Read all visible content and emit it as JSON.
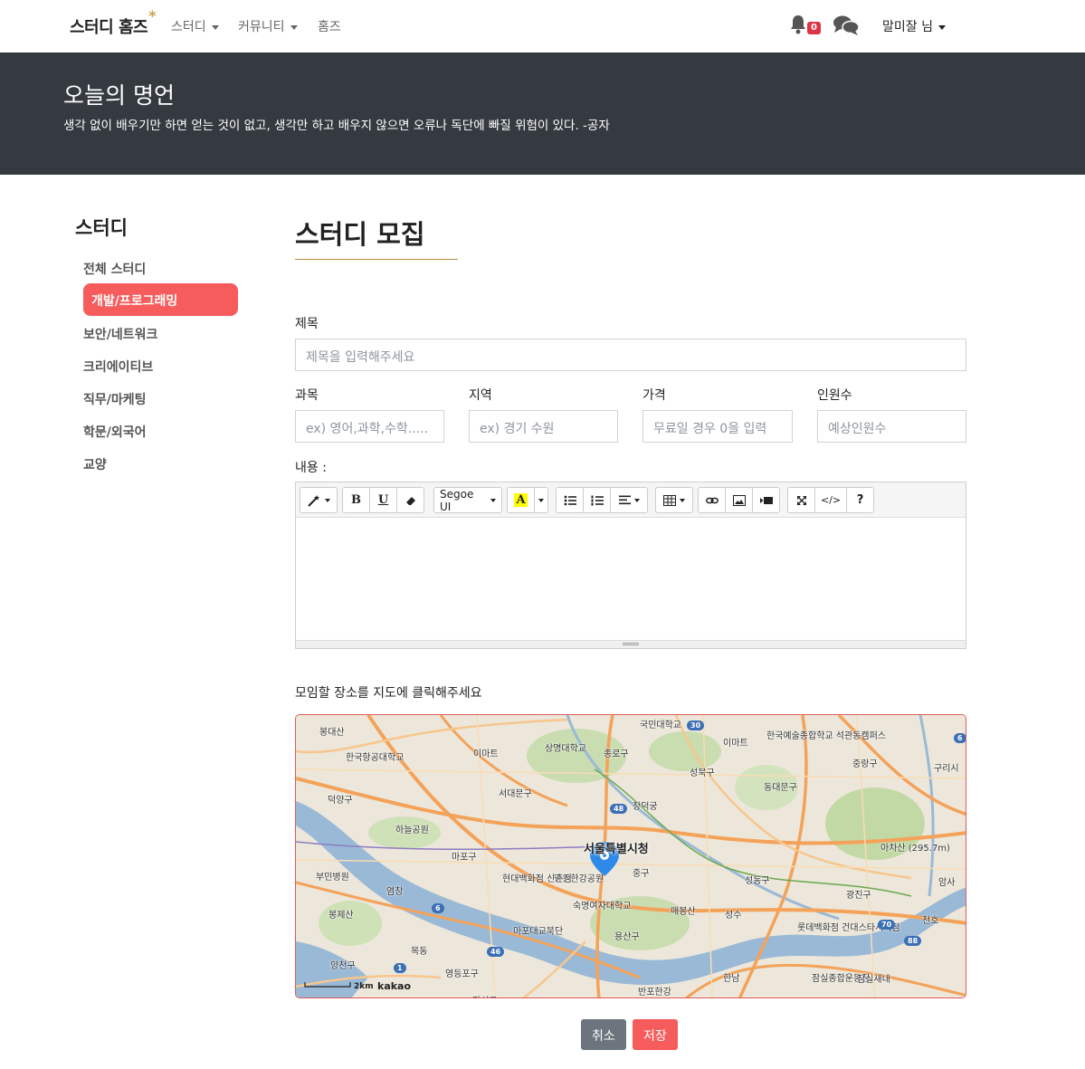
{
  "navbar": {
    "brand": "스터디 홈즈",
    "brand_mark": "*",
    "menu": [
      {
        "label": "스터디",
        "dropdown": true
      },
      {
        "label": "커뮤니티",
        "dropdown": true
      },
      {
        "label": "홈즈",
        "dropdown": false
      }
    ],
    "notification_count": "0",
    "user_label": "말미잘 님"
  },
  "hero": {
    "title": "오늘의 명언",
    "quote": "생각 없이 배우기만 하면 얻는 것이 없고, 생각만 하고 배우지 않으면 오류나 독단에 빠질 위험이 있다. -공자"
  },
  "sidebar": {
    "title": "스터디",
    "items": [
      {
        "label": "전체 스터디",
        "active": false
      },
      {
        "label": "개발/프로그래밍",
        "active": true
      },
      {
        "label": "보안/네트워크",
        "active": false
      },
      {
        "label": "크리에이티브",
        "active": false
      },
      {
        "label": "직무/마케팅",
        "active": false
      },
      {
        "label": "학문/외국어",
        "active": false
      },
      {
        "label": "교양",
        "active": false
      }
    ]
  },
  "form": {
    "page_title": "스터디 모집",
    "title_label": "제목",
    "title_placeholder": "제목을 입력해주세요",
    "subject_label": "과목",
    "subject_placeholder": "ex) 영어,과학,수학.....",
    "region_label": "지역",
    "region_placeholder": "ex) 경기 수원",
    "price_label": "가격",
    "price_placeholder": "무료일 경우 0을 입력",
    "people_label": "인원수",
    "people_placeholder": "예상인원수",
    "content_label": "내용 :",
    "editor": {
      "font_name": "Segoe UI",
      "bold": "B",
      "underline": "U",
      "highlight": "A",
      "help": "?",
      "code": "</>"
    },
    "map_instruction": "모임할 장소를 지도에 클릭해주세요",
    "cancel_label": "취소",
    "save_label": "저장"
  },
  "map": {
    "scale_label": "2km",
    "provider": "kakao",
    "center_label": "서울특별시청",
    "places": [
      "봉대산",
      "한국항공대학교",
      "이마트",
      "상명대학교",
      "종로구",
      "국민대학교",
      "이마트",
      "한국예술종합학교 석관동캠퍼스",
      "중랑구",
      "구리시",
      "덕양구",
      "성북구",
      "동대문구",
      "서대문구",
      "창덕궁",
      "하늘공원",
      "마포구",
      "중구",
      "아차산 (295.7m)",
      "부민병원",
      "망원한강공원",
      "현대백화점 신촌점",
      "성동구",
      "광진구",
      "암사",
      "봉제산",
      "숙명여자대학교",
      "매봉산",
      "성수",
      "롯데백화점 건대스타시티점",
      "천호",
      "마포대교북단",
      "용산구",
      "목동",
      "양천구",
      "영등포구",
      "한남",
      "잠실종합운동장",
      "잠실새내",
      "반포한강",
      "강서구",
      "염창"
    ],
    "road_numbers": [
      "30",
      "48",
      "6",
      "46",
      "1",
      "70",
      "88",
      "6"
    ]
  },
  "colors": {
    "accent": "#f75c5c",
    "hero_bg": "#343a40",
    "title_underline": "#b8863b",
    "badge": "#dc3545",
    "cancel": "#6c757d"
  },
  "icons": {
    "notification": "bell-icon",
    "messages": "chat-bubbles-icon",
    "map_marker": "map-pin-icon"
  }
}
